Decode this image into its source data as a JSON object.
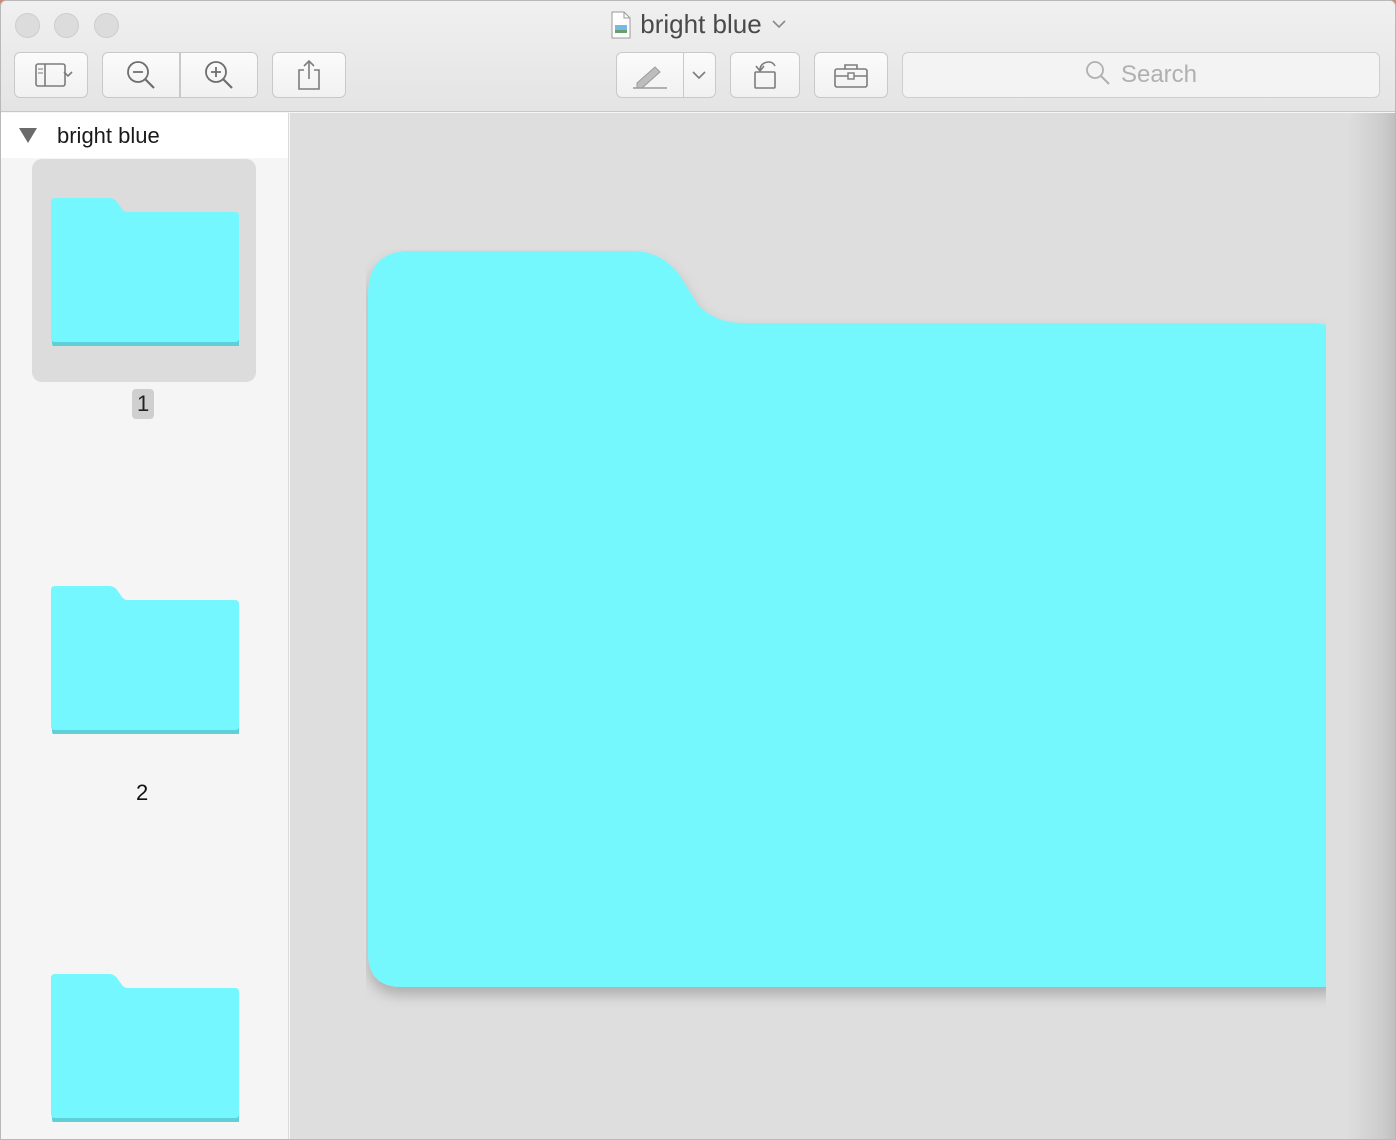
{
  "window": {
    "title": "bright blue",
    "title_dropdown_icon": "chevron-down-icon"
  },
  "toolbar": {
    "search_placeholder": "Search"
  },
  "sidebar": {
    "document_name": "bright blue",
    "pages": [
      {
        "number": "1",
        "selected": true
      },
      {
        "number": "2",
        "selected": false
      },
      {
        "number": "",
        "selected": false
      }
    ]
  },
  "colors": {
    "folder": "#74f7fe",
    "folder_shadow": "#5fd9e0"
  }
}
